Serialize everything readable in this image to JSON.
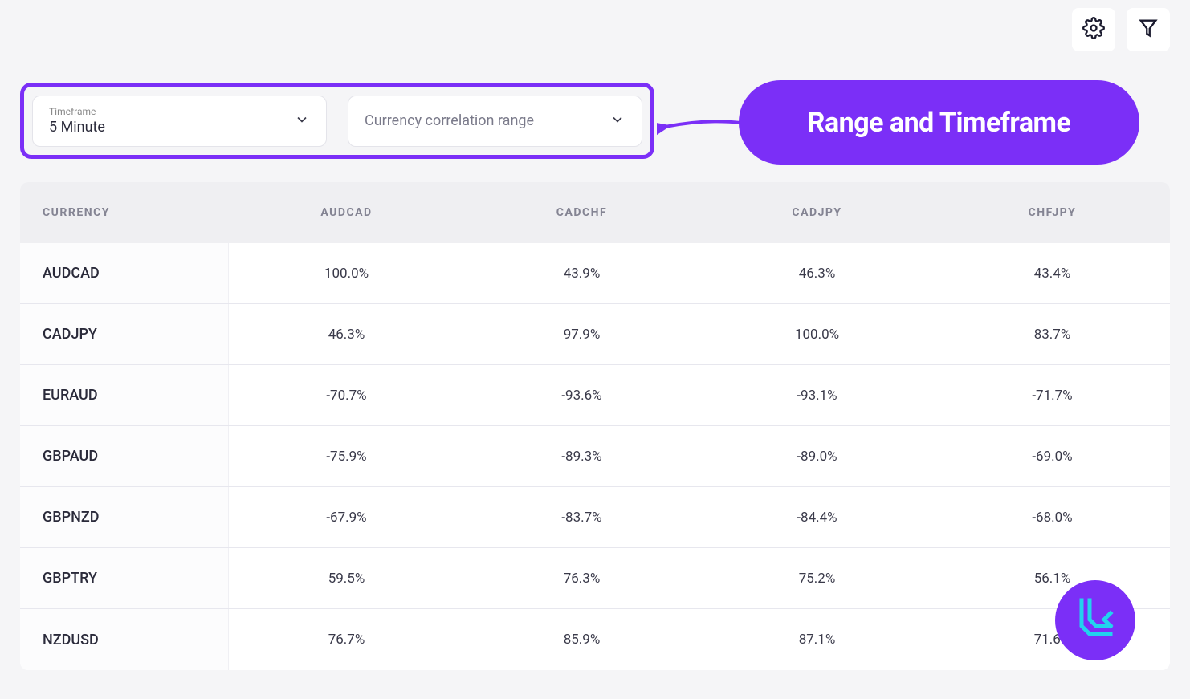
{
  "controls": {
    "timeframe_label": "Timeframe",
    "timeframe_value": "5 Minute",
    "correlation_placeholder": "Currency correlation range"
  },
  "callout": {
    "text": "Range and Timeframe"
  },
  "table": {
    "currency_header": "CURRENCY",
    "columns": [
      "AUDCAD",
      "CADCHF",
      "CADJPY",
      "CHFJPY"
    ],
    "rows": [
      {
        "currency": "AUDCAD",
        "values": [
          "100.0%",
          "43.9%",
          "46.3%",
          "43.4%"
        ]
      },
      {
        "currency": "CADJPY",
        "values": [
          "46.3%",
          "97.9%",
          "100.0%",
          "83.7%"
        ]
      },
      {
        "currency": "EURAUD",
        "values": [
          "-70.7%",
          "-93.6%",
          "-93.1%",
          "-71.7%"
        ]
      },
      {
        "currency": "GBPAUD",
        "values": [
          "-75.9%",
          "-89.3%",
          "-89.0%",
          "-69.0%"
        ]
      },
      {
        "currency": "GBPNZD",
        "values": [
          "-67.9%",
          "-83.7%",
          "-84.4%",
          "-68.0%"
        ]
      },
      {
        "currency": "GBPTRY",
        "values": [
          "59.5%",
          "76.3%",
          "75.2%",
          "56.1%"
        ]
      },
      {
        "currency": "NZDUSD",
        "values": [
          "76.7%",
          "85.9%",
          "87.1%",
          "71.6%"
        ]
      }
    ]
  }
}
